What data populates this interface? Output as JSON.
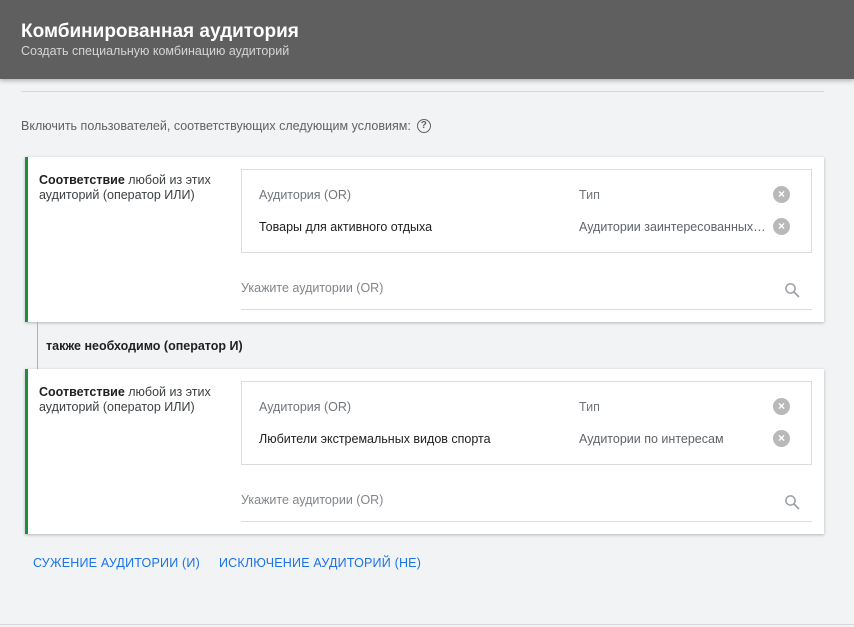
{
  "header": {
    "title": "Комбинированная аудитория",
    "subtitle": "Создать специальную комбинацию аудиторий"
  },
  "include": {
    "text": "Включить пользователей, соответствующих следующим условиям:",
    "help_icon": "?"
  },
  "groups": [
    {
      "match_strong": "Соответствие",
      "match_rest": " любой из этих аудиторий (оператор ИЛИ)",
      "col_audience": "Аудитория (OR)",
      "col_type": "Тип",
      "rows": [
        {
          "audience": "Товары для активного отдыха",
          "type": "Аудитории заинтересованных покупателей"
        }
      ],
      "search_placeholder": "Укажите аудитории (OR)"
    },
    {
      "match_strong": "Соответствие",
      "match_rest": " любой из этих аудиторий (оператор ИЛИ)",
      "col_audience": "Аудитория (OR)",
      "col_type": "Тип",
      "rows": [
        {
          "audience": "Любители экстремальных видов спорта",
          "type": "Аудитории по интересам"
        }
      ],
      "search_placeholder": "Укажите аудитории (OR)"
    }
  ],
  "and_connector": "также необходимо (оператор И)",
  "actions": {
    "narrow": "СУЖЕНИЕ АУДИТОРИИ (И)",
    "exclude": "ИСКЛЮЧЕНИЕ АУДИТОРИЙ (НЕ)"
  },
  "icons": {
    "remove": "close-circle-icon",
    "search": "search-icon",
    "help": "help-circle-icon"
  },
  "colors": {
    "header_bg": "#5f5f5f",
    "accent_green": "#1e8e3e",
    "link_blue": "#1a73e8"
  }
}
